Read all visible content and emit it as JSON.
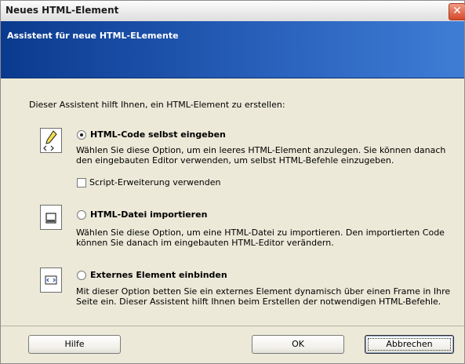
{
  "window": {
    "title": "Neues HTML-Element",
    "close_label": "✕"
  },
  "banner": {
    "title": "Assistent für neue HTML-ELemente"
  },
  "intro": "Dieser Assistent hilft Ihnen, ein HTML-Element zu erstellen:",
  "options": [
    {
      "label": "HTML-Code selbst eingeben",
      "selected": true,
      "description": "Wählen Sie diese Option, um ein leeres HTML-Element anzulegen. Sie können danach den eingebauten Editor verwenden, um selbst HTML-Befehle einzugeben.",
      "checkbox_label": "Script-Erweiterung verwenden",
      "checkbox_checked": false,
      "icon": "pencil-code-icon"
    },
    {
      "label": "HTML-Datei importieren",
      "selected": false,
      "description": "Wählen Sie diese Option, um eine HTML-Datei zu importieren. Den importierten Code können Sie danach im eingebauten HTML-Editor verändern.",
      "icon": "html-file-icon"
    },
    {
      "label": "Externes Element einbinden",
      "selected": false,
      "description": "Mit dieser Option betten Sie ein externes Element dynamisch über einen Frame in Ihre Seite ein. Dieser Assistent hilft Ihnen beim Erstellen der notwendigen HTML-Befehle.",
      "icon": "external-code-icon"
    }
  ],
  "buttons": {
    "help": "Hilfe",
    "ok": "OK",
    "cancel": "Abbrechen"
  }
}
